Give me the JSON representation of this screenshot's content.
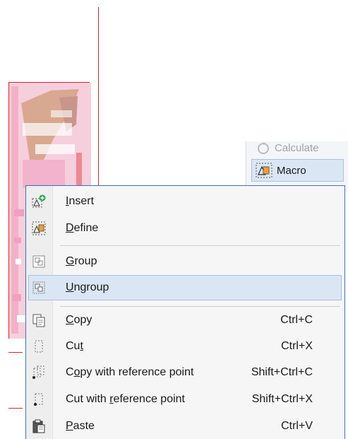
{
  "ribbon": {
    "calculate_label": "Calculate",
    "macro_label": "Macro"
  },
  "menu": {
    "items": [
      {
        "name": "insert",
        "label_pre": "",
        "label_key": "I",
        "label_post": "nsert",
        "shortcut": "",
        "icon": "insert-macro-icon"
      },
      {
        "name": "define",
        "label_pre": "",
        "label_key": "D",
        "label_post": "efine",
        "shortcut": "",
        "icon": "define-macro-icon"
      },
      {
        "name": "group",
        "label_pre": "",
        "label_key": "G",
        "label_post": "roup",
        "shortcut": "",
        "icon": "group-icon"
      },
      {
        "name": "ungroup",
        "label_pre": "",
        "label_key": "U",
        "label_post": "ngroup",
        "shortcut": "",
        "icon": "ungroup-icon"
      },
      {
        "name": "copy",
        "label_pre": "",
        "label_key": "C",
        "label_post": "opy",
        "shortcut": "Ctrl+C",
        "icon": "copy-icon"
      },
      {
        "name": "cut",
        "label_pre": "Cu",
        "label_key": "t",
        "label_post": "",
        "shortcut": "Ctrl+X",
        "icon": "cut-icon"
      },
      {
        "name": "copy-with-reference-point",
        "label_pre": "C",
        "label_key": "o",
        "label_post": "py with reference point",
        "shortcut": "Shift+Ctrl+C",
        "icon": "copy-reference-icon"
      },
      {
        "name": "cut-with-reference-point",
        "label_pre": "Cut with ",
        "label_key": "r",
        "label_post": "eference point",
        "shortcut": "Shift+Ctrl+X",
        "icon": "cut-reference-icon"
      },
      {
        "name": "paste",
        "label_pre": "",
        "label_key": "P",
        "label_post": "aste",
        "shortcut": "Ctrl+V",
        "icon": "paste-icon"
      }
    ]
  },
  "colors": {
    "menu_border": "#3a73b8",
    "highlight": "#dbe6f4",
    "drawing_line": "#e0202a",
    "drawing_fill": "#d8a890"
  }
}
